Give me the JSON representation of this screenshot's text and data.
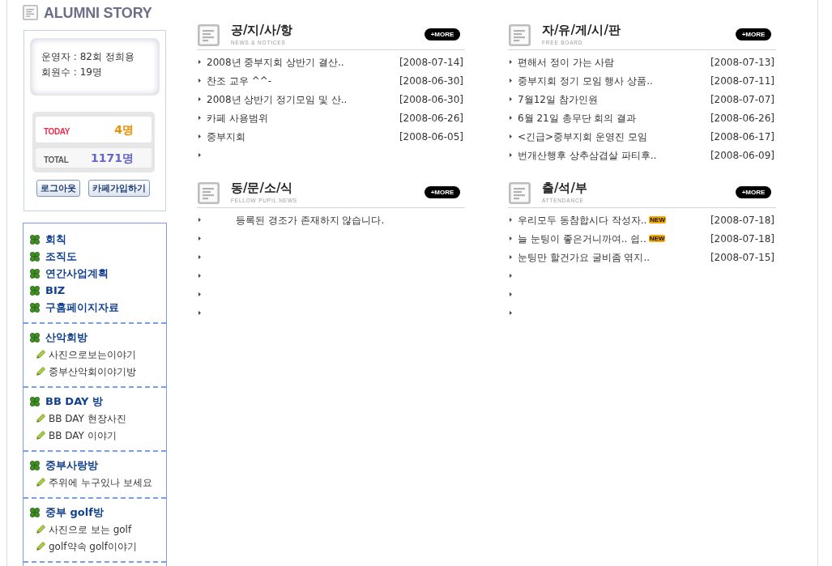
{
  "sidebar": {
    "title": "ALUMNI STORY",
    "profile": {
      "lines": [
        "운영자 : 82회 정희용",
        "회원수 : 19명"
      ]
    },
    "counters": [
      {
        "kind": "today",
        "label": "TODAY",
        "value": "4명"
      },
      {
        "kind": "total",
        "label": "TOTAL",
        "value": "1171명"
      }
    ],
    "buttons": [
      "로그아웃",
      "카페가입하기"
    ],
    "menu_groups": [
      {
        "items": [
          {
            "label": "회칙"
          },
          {
            "label": "조직도"
          },
          {
            "label": "연간사업계획"
          },
          {
            "label": "BIZ"
          },
          {
            "label": "구홈페이지자료"
          }
        ]
      },
      {
        "items": [
          {
            "label": "산악회방",
            "children": [
              {
                "label": "사진으로보는이야기"
              },
              {
                "label": "중부산악회이야기방"
              }
            ]
          }
        ]
      },
      {
        "items": [
          {
            "label": "BB DAY 방",
            "children": [
              {
                "label": "BB DAY 현장사진"
              },
              {
                "label": "BB DAY 이야기"
              }
            ]
          }
        ]
      },
      {
        "items": [
          {
            "label": "중부사랑방",
            "children": [
              {
                "label": "주위에 누구있나 보세요"
              }
            ]
          }
        ]
      },
      {
        "items": [
          {
            "label": "중부 golf방",
            "children": [
              {
                "label": "사진으로 보는 golf"
              },
              {
                "label": "golf약속 golf이야기"
              }
            ]
          }
        ]
      }
    ]
  },
  "boards": [
    {
      "title": "공/지/사/항",
      "subtitle": "NEWS & NOTICES",
      "more": "+MORE",
      "rows": [
        {
          "kind": "post",
          "title": "2008년 중부지회 상반기 결산..",
          "date": "[2008-07-14]"
        },
        {
          "kind": "post",
          "title": "찬조 교우 ^^-",
          "date": "[2008-06-30]"
        },
        {
          "kind": "post",
          "title": "2008년 상반기 정기모임 및 산..",
          "date": "[2008-06-30]"
        },
        {
          "kind": "post",
          "title": "카페 사용범위",
          "date": "[2008-06-26]"
        },
        {
          "kind": "post",
          "title": "중부지회",
          "date": "[2008-06-05]"
        },
        {
          "kind": "blank"
        }
      ]
    },
    {
      "title": "자/유/게/시/판",
      "subtitle": "FREE BOARD",
      "more": "+MORE",
      "rows": [
        {
          "kind": "post",
          "title": "편해서 정이 가는 사람",
          "date": "[2008-07-13]"
        },
        {
          "kind": "post",
          "title": "중부지회 정기 모임 행사 상품..",
          "date": "[2008-07-11]"
        },
        {
          "kind": "post",
          "title": "7월12일 참가인원",
          "date": "[2008-07-07]"
        },
        {
          "kind": "post",
          "title": "6월 21일 총무단 회의 결과",
          "date": "[2008-06-26]"
        },
        {
          "kind": "post",
          "title": "<긴급>중부지회 운영진 모임",
          "date": "[2008-06-17]"
        },
        {
          "kind": "post",
          "title": "번개산행후 상추삼겹살 파티후..",
          "date": "[2008-06-09]"
        }
      ]
    },
    {
      "title": "동/문/소/식",
      "subtitle": "FELLOW PUPIL NEWS",
      "more": "+MORE",
      "rows": [
        {
          "kind": "message",
          "title": "등록된 경조가 존재하지 않습니다."
        },
        {
          "kind": "blank"
        },
        {
          "kind": "blank"
        },
        {
          "kind": "blank"
        },
        {
          "kind": "blank"
        },
        {
          "kind": "blank"
        }
      ]
    },
    {
      "title": "출/석/부",
      "subtitle": "ATTENDANCE",
      "more": "+MORE",
      "rows": [
        {
          "kind": "post",
          "title": "우리모두 동참합시다 작성자..",
          "badge": "NEW",
          "date": "[2008-07-18]"
        },
        {
          "kind": "post",
          "title": "늘 눈팅이 좋은거니까여.. 쉽..",
          "badge": "NEW",
          "date": "[2008-07-18]"
        },
        {
          "kind": "post",
          "title": "눈팅만 할건가요 굴비좀 엮지..",
          "date": "[2008-07-15]"
        },
        {
          "kind": "blank"
        },
        {
          "kind": "blank"
        },
        {
          "kind": "blank"
        }
      ]
    }
  ]
}
